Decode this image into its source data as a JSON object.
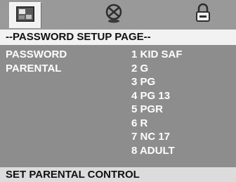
{
  "tabs": [
    {
      "icon": "general-setup-icon",
      "active": true
    },
    {
      "icon": "audio-setup-icon",
      "active": false
    },
    {
      "icon": "lock-icon",
      "active": false
    }
  ],
  "page_title": "--PASSWORD SETUP PAGE--",
  "menu": {
    "items": [
      "PASSWORD",
      "PARENTAL"
    ]
  },
  "parental_options": [
    "1 KID SAF",
    "2 G",
    "3 PG",
    "4 PG 13",
    "5 PGR",
    "6 R",
    "7 NC 17",
    "8 ADULT"
  ],
  "status_text": "SET PARENTAL CONTROL",
  "colors": {
    "background": "#8d8d8d",
    "banner": "#f2f2f2",
    "text": "#ffffff",
    "footer": "#dcdcdc"
  }
}
